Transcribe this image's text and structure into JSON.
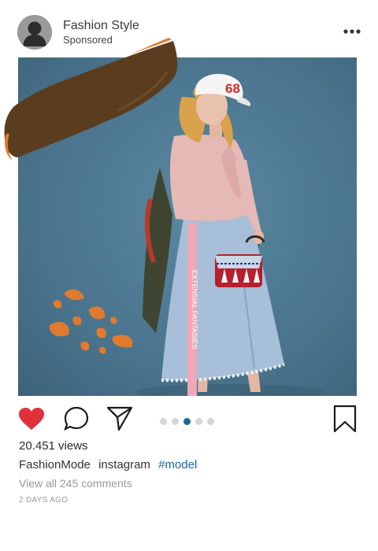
{
  "post": {
    "profile_name": "Fashion Style",
    "sponsored": "Sponsored",
    "views": "20.451 views",
    "caption": {
      "username": "FashionMode",
      "text": "instagram",
      "hashtag": "#model"
    },
    "comments_link": "View all 245 comments",
    "age": "2 DAYS AGO"
  },
  "photo": {
    "cap_text": "68",
    "skirt_text": "EXTENSIAL FANTASIES",
    "colors": {
      "background": "#4c7690",
      "brush": "#5a3d1f",
      "accent": "#e07b2e",
      "sweater": "#e5b9b5",
      "denim": "#a7bfd8"
    }
  },
  "carousel": {
    "count": 5,
    "active": 3
  },
  "actions": {
    "like": {
      "icon": "heart-icon",
      "liked": true,
      "color": "#e0303a"
    },
    "comment": {
      "icon": "comment-bubble-icon"
    },
    "share": {
      "icon": "paper-plane-icon"
    },
    "save": {
      "icon": "bookmark-icon"
    },
    "more": {
      "icon": "more-dots-icon"
    }
  }
}
